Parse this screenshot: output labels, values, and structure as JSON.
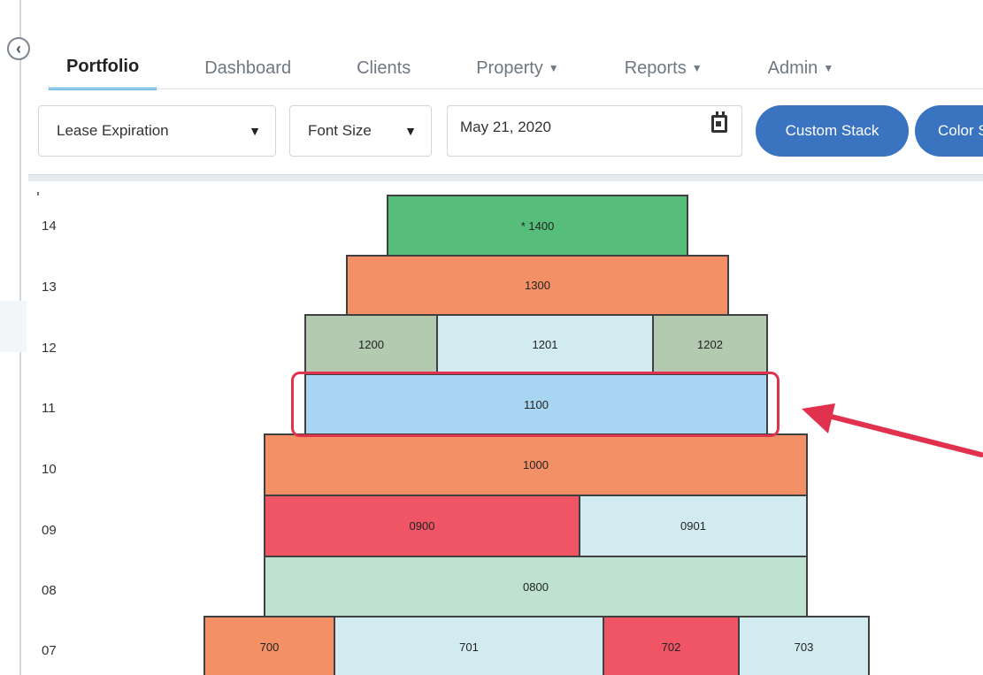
{
  "nav": {
    "tabs": [
      {
        "label": "Portfolio",
        "active": true,
        "dropdown": false
      },
      {
        "label": "Dashboard",
        "active": false,
        "dropdown": false
      },
      {
        "label": "Clients",
        "active": false,
        "dropdown": false
      },
      {
        "label": "Property",
        "active": false,
        "dropdown": true
      },
      {
        "label": "Reports",
        "active": false,
        "dropdown": true
      },
      {
        "label": "Admin",
        "active": false,
        "dropdown": true
      }
    ]
  },
  "toolbar": {
    "view_select": "Lease Expiration",
    "font_size_select": "Font Size",
    "date_value": "May 21, 2020",
    "custom_stack_label": "Custom Stack",
    "color_button_label": "Color S"
  },
  "stack": {
    "floors": [
      "14",
      "13",
      "12",
      "11",
      "10",
      "09",
      "08",
      "07"
    ],
    "units": [
      {
        "label": "* 1400",
        "color": "#56bd7a"
      },
      {
        "label": "1300",
        "color": "#f49066"
      },
      {
        "label": "1200",
        "color": "#b3cab1"
      },
      {
        "label": "1201",
        "color": "#d1ebf1"
      },
      {
        "label": "1202",
        "color": "#b3cab1"
      },
      {
        "label": "1100",
        "color": "#a8d5f2"
      },
      {
        "label": "1000",
        "color": "#f49066"
      },
      {
        "label": "0900",
        "color": "#f05565"
      },
      {
        "label": "0901",
        "color": "#d1ebf1"
      },
      {
        "label": "0800",
        "color": "#bfe2d0"
      },
      {
        "label": "700",
        "color": "#f49066"
      },
      {
        "label": "701",
        "color": "#d1ebf1"
      },
      {
        "label": "702",
        "color": "#f05565"
      },
      {
        "label": "703",
        "color": "#d1ebf1"
      }
    ]
  },
  "annotation": {
    "color": "#e0324e"
  }
}
